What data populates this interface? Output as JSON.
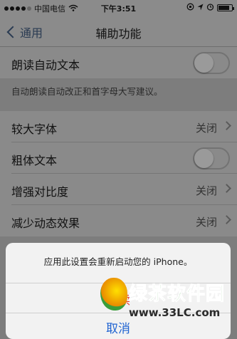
{
  "status_bar": {
    "carrier": "中国电信",
    "time": "下午3:51",
    "battery_level": 0.85
  },
  "nav": {
    "back_label": "通用",
    "title": "辅助功能"
  },
  "settings": {
    "speak_auto_text": {
      "label": "朗读自动文本",
      "toggle_on": false
    },
    "speak_auto_text_footnote": "自动朗读自动改正和首字母大写建议。",
    "larger_text": {
      "label": "较大字体",
      "value": "关闭"
    },
    "bold_text": {
      "label": "粗体文本",
      "toggle_on": false
    },
    "increase_contrast": {
      "label": "增强对比度",
      "value": "关闭"
    },
    "reduce_motion": {
      "label": "减少动态效果",
      "value": "关闭"
    }
  },
  "alert": {
    "message": "应用此设置会重新启动您的 iPhone。",
    "continue_label": "继续",
    "cancel_label": "取消"
  },
  "watermark": {
    "title": "绿茶软件园",
    "url": "www.33LC.com"
  },
  "colors": {
    "alert_continue": "#e23a2e",
    "alert_cancel": "#1f63d1",
    "watermark_green": "#3aa63a"
  }
}
